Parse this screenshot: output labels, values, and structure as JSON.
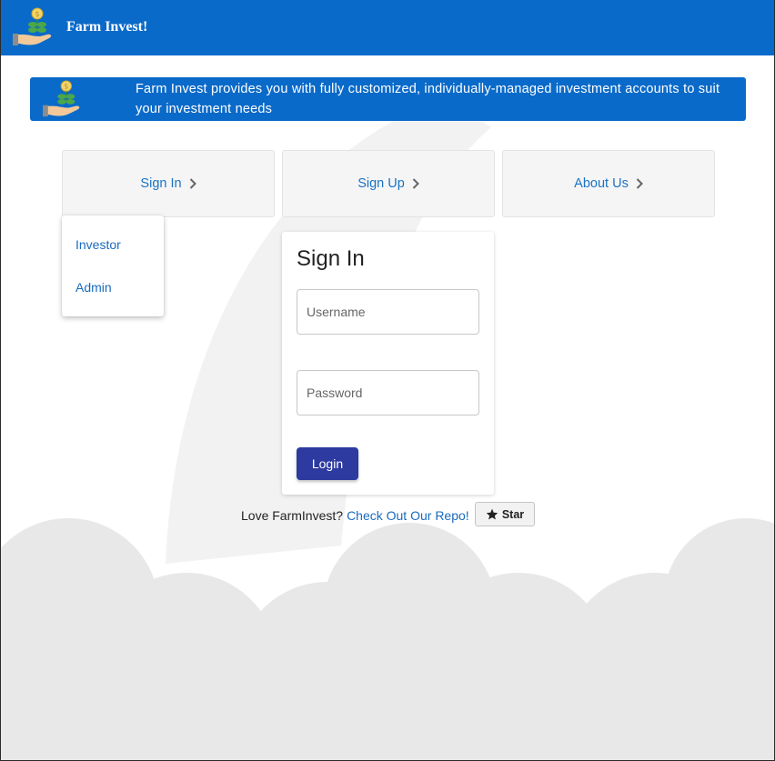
{
  "appbar": {
    "brand": "Farm Invest!",
    "logo_icon": "hand-holding-coin-plant-icon"
  },
  "banner": {
    "text": "Farm Invest provides you with fully customized, individually-managed investment accounts to suit your investment needs",
    "logo_icon": "hand-holding-coin-plant-icon"
  },
  "nav": {
    "signin": "Sign In",
    "signup": "Sign Up",
    "about": "About Us"
  },
  "menu": {
    "items": [
      "Investor",
      "Admin"
    ]
  },
  "signin_form": {
    "title": "Sign In",
    "username_placeholder": "Username",
    "password_placeholder": "Password",
    "login_label": "Login"
  },
  "footer": {
    "prompt": "Love FarmInvest?",
    "link": "Check Out Our Repo!",
    "star_label": "Star"
  },
  "colors": {
    "primary": "#0a6ac9",
    "button": "#2d3aa0",
    "link": "#1a6bbf"
  }
}
